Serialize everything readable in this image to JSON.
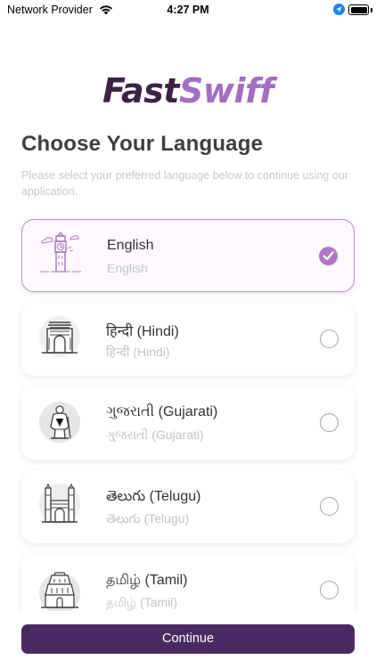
{
  "status_bar": {
    "carrier": "Network Provider",
    "time": "4:27 PM"
  },
  "logo": {
    "part1": "Fast",
    "part2": "Swiff"
  },
  "header": {
    "title": "Choose Your Language",
    "subtitle": "Please select your preferred language below to continue using our application."
  },
  "languages": [
    {
      "name": "English",
      "native": "English",
      "selected": true
    },
    {
      "name": "हिन्दी (Hindi)",
      "native": "हिन्दी (Hindi)",
      "selected": false
    },
    {
      "name": "ગુજરાતી (Gujarati)",
      "native": "ગુજરાતી (Gujarati)",
      "selected": false
    },
    {
      "name": "తెలుగు (Telugu)",
      "native": "తెలుగు (Telugu)",
      "selected": false
    },
    {
      "name": "தமிழ் (Tamil)",
      "native": "தமிழ் (Tamil)",
      "selected": false
    }
  ],
  "continue_label": "Continue",
  "colors": {
    "accent": "#b277c6",
    "button": "#4b2a64",
    "logo_dark": "#3d2246",
    "logo_light": "#a36dc2"
  }
}
